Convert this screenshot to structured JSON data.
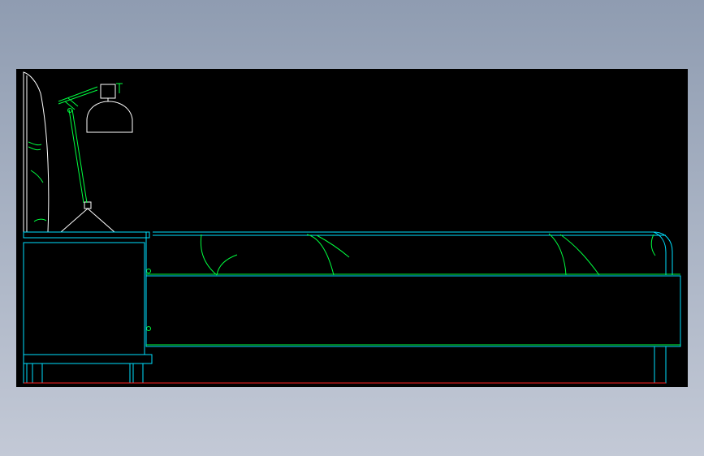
{
  "canvas": {
    "background": "#000000",
    "window_background": "gradient-gray-blue"
  },
  "colors": {
    "cyan": "#00e0ff",
    "green": "#00ff40",
    "white": "#ffffff",
    "red": "#ff2020"
  },
  "objects": [
    "headboard",
    "cushion",
    "desk-lamp",
    "nightstand",
    "bed-mattress",
    "bed-base",
    "pillows",
    "floor-line"
  ]
}
